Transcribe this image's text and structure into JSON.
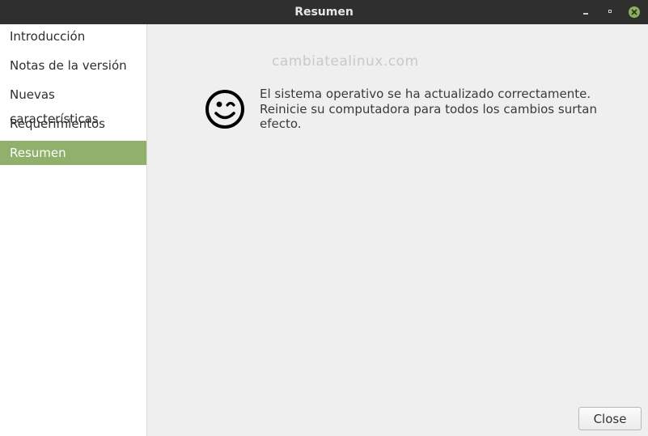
{
  "window": {
    "title": "Resumen",
    "controls": [
      "minimize-icon",
      "maximize-icon",
      "close-icon"
    ],
    "accent_color": "#90b06c"
  },
  "sidebar": {
    "items": [
      {
        "label": "Introducción",
        "active": false
      },
      {
        "label": "Notas de la versión",
        "active": false
      },
      {
        "label": "Nuevas características",
        "active": false
      },
      {
        "label": "Requerimientos",
        "active": false
      },
      {
        "label": "Resumen",
        "active": true
      }
    ]
  },
  "main": {
    "watermark": "cambiatealinux.com",
    "icon": "winking-smiley-icon",
    "message": "El sistema operativo se ha actualizado correctamente. Reinicie su computadora para todos los cambios surtan efecto."
  },
  "footer": {
    "close_label": "Close"
  }
}
